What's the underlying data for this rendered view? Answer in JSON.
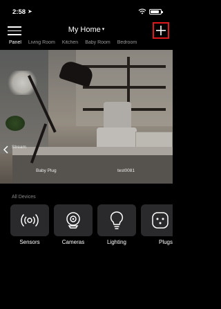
{
  "status": {
    "time": "2:58"
  },
  "header": {
    "title": "My Home",
    "caret": "▾"
  },
  "tabs": [
    {
      "label": "Panel",
      "active": true
    },
    {
      "label": "Living Room",
      "active": false
    },
    {
      "label": "Kitchen",
      "active": false
    },
    {
      "label": "Baby Room",
      "active": false
    },
    {
      "label": "Bedroom",
      "active": false
    }
  ],
  "camera": {
    "stream_label": "Stream",
    "plug_label": "Baby Plug",
    "device_label": "test0081"
  },
  "devices": {
    "section_title": "All Devices",
    "items": [
      {
        "label": "Sensors",
        "icon": "sensor-icon"
      },
      {
        "label": "Cameras",
        "icon": "camera-icon"
      },
      {
        "label": "Lighting",
        "icon": "bulb-icon"
      },
      {
        "label": "Plugs",
        "icon": "plug-icon"
      }
    ]
  },
  "colors": {
    "accent_highlight": "#e0181c",
    "background": "#000000",
    "tile": "#2a2a2c"
  }
}
